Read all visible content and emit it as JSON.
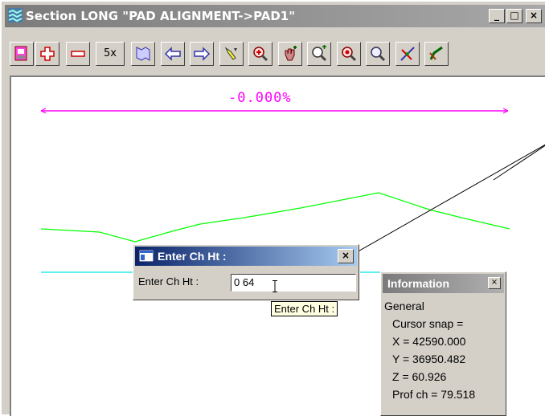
{
  "window": {
    "title": "Section LONG \"PAD ALIGNMENT->PAD1\"",
    "minimize_label": "_",
    "maximize_label": "□",
    "close_label": "×"
  },
  "toolbar": {
    "tools": [
      {
        "name": "plot-icon"
      },
      {
        "name": "zoom-in-plus-icon"
      },
      {
        "name": "zoom-out-minus-icon"
      },
      {
        "name": "zoom-5x-button",
        "label": "5x"
      },
      {
        "name": "fit-view-icon"
      },
      {
        "name": "pan-left-icon"
      },
      {
        "name": "pan-right-icon"
      },
      {
        "name": "pick-tool-icon"
      },
      {
        "name": "zoom-window-icon"
      },
      {
        "name": "hand-pan-icon"
      },
      {
        "name": "zoom-centre-icon"
      },
      {
        "name": "zoom-target-icon"
      },
      {
        "name": "magnify-icon"
      },
      {
        "name": "cursor-snap-icon"
      },
      {
        "name": "pencil-icon"
      }
    ]
  },
  "canvas": {
    "grade_label": "-0.000%",
    "colors": {
      "grade": "#ff00ff",
      "profile": "#00ff00",
      "datum": "#00e5e5",
      "leader": "#000000"
    }
  },
  "dialog": {
    "title": "Enter Ch Ht :",
    "label": "Enter Ch Ht :",
    "input_value": "0 64",
    "close_label": "×",
    "tooltip": "Enter Ch Ht :"
  },
  "info": {
    "title": "Information",
    "close_label": "×",
    "heading": "General",
    "snap": "Cursor snap =",
    "x": "X = 42590.000",
    "y": "Y = 36950.482",
    "z": "Z = 60.926",
    "prof_ch": "Prof ch = 79.518"
  }
}
